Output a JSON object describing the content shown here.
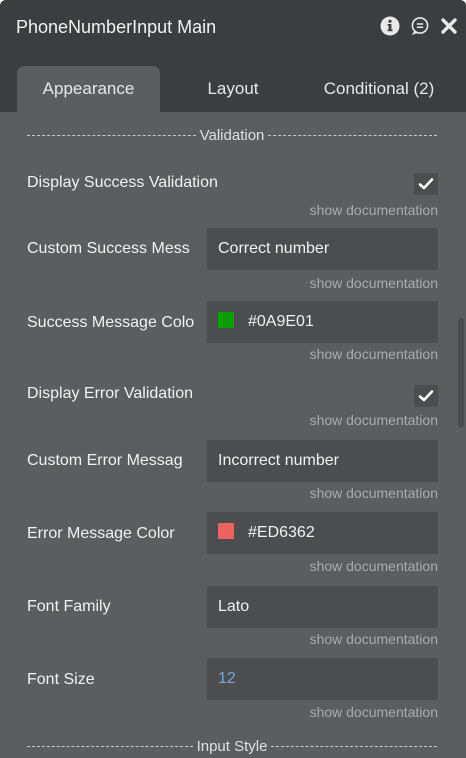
{
  "window": {
    "title": "PhoneNumberInput Main"
  },
  "tabs": [
    {
      "label": "Appearance",
      "active": true
    },
    {
      "label": "Layout",
      "active": false
    },
    {
      "label": "Conditional (2)",
      "active": false
    }
  ],
  "sections": {
    "validation": "Validation",
    "input_style": "Input Style"
  },
  "docs_label": "show documentation",
  "fields": {
    "display_success_validation": {
      "label": "Display Success Validation",
      "checked": true
    },
    "custom_success_message": {
      "label": "Custom Success Mess",
      "value": "Correct number"
    },
    "success_message_color": {
      "label": "Success Message Colo",
      "value": "#0A9E01",
      "swatch": "#0A9E01"
    },
    "display_error_validation": {
      "label": "Display Error Validation",
      "checked": true
    },
    "custom_error_message": {
      "label": "Custom Error Messag",
      "value": "Incorrect number"
    },
    "error_message_color": {
      "label": "Error Message Color",
      "value": "#ED6362",
      "swatch": "#ED6362"
    },
    "font_family": {
      "label": "Font Family",
      "value": "Lato"
    },
    "font_size": {
      "label": "Font Size",
      "value": "12"
    }
  },
  "icons": [
    "info-icon",
    "comment-icon",
    "close-icon",
    "checkmark-icon"
  ],
  "colors": {
    "panel_bg": "#5b5d5f",
    "header_bg": "#3b3d3f",
    "input_bg": "#4b4d4f",
    "numeric_value": "#7aa6d8"
  }
}
